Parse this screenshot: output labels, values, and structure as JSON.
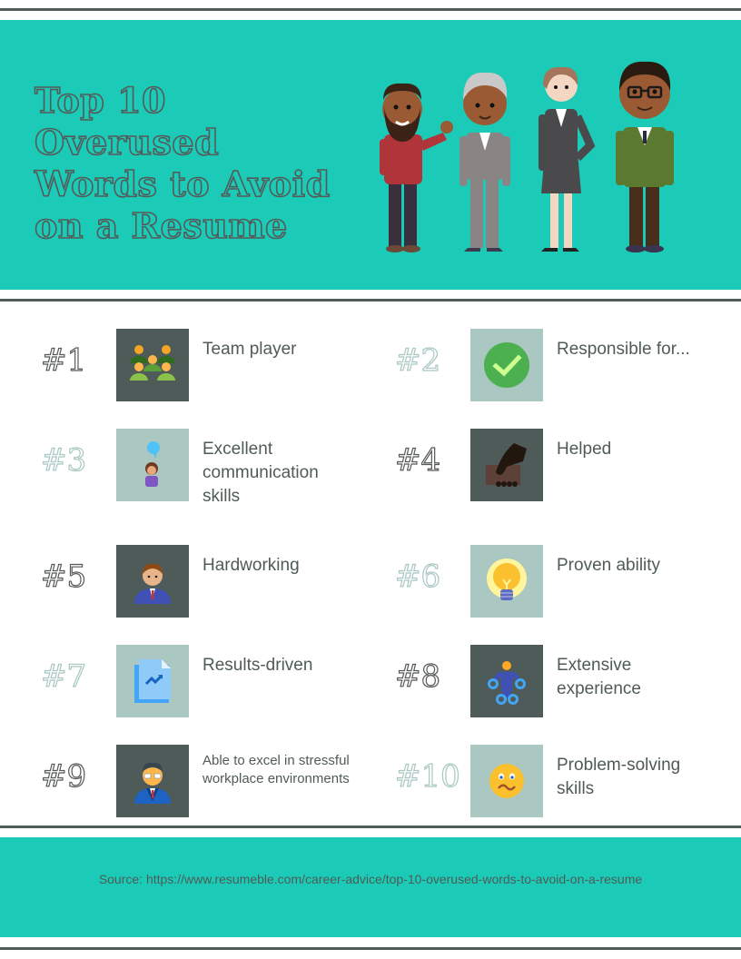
{
  "header": {
    "title_lines": [
      "Top 10",
      "Overused",
      "Words to Avoid",
      "on a Resume"
    ],
    "illustration": "four-professionals-illustration"
  },
  "items": [
    {
      "rank": "#1",
      "label": "Team player",
      "icon": "team-icon",
      "tile": "dark"
    },
    {
      "rank": "#2",
      "label": "Responsible for...",
      "icon": "checkmark-icon",
      "tile": "light"
    },
    {
      "rank": "#3",
      "label": "Excellent communication skills",
      "icon": "speaking-person-icon",
      "tile": "light"
    },
    {
      "rank": "#4",
      "label": "Helped",
      "icon": "handshake-icon",
      "tile": "dark"
    },
    {
      "rank": "#5",
      "label": "Hardworking",
      "icon": "businessman-icon",
      "tile": "dark"
    },
    {
      "rank": "#6",
      "label": "Proven ability",
      "icon": "lightbulb-icon",
      "tile": "light"
    },
    {
      "rank": "#7",
      "label": "Results-driven",
      "icon": "growth-document-icon",
      "tile": "light"
    },
    {
      "rank": "#8",
      "label": "Extensive experience",
      "icon": "stretching-person-icon",
      "tile": "dark"
    },
    {
      "rank": "#9",
      "label": "Able to excel in stressful workplace environments",
      "icon": "stressed-businessman-icon",
      "tile": "dark"
    },
    {
      "rank": "#10",
      "label": "Problem-solving skills",
      "icon": "confused-face-icon",
      "tile": "light"
    }
  ],
  "footer": {
    "source": "Source: https://www.resumeble.com/career-advice/top-10-overused-words-to-avoid-on-a-resume"
  },
  "colors": {
    "teal": "#1bcbb7",
    "dark_slate": "#4f5b58",
    "light_sage": "#abc7c2"
  }
}
